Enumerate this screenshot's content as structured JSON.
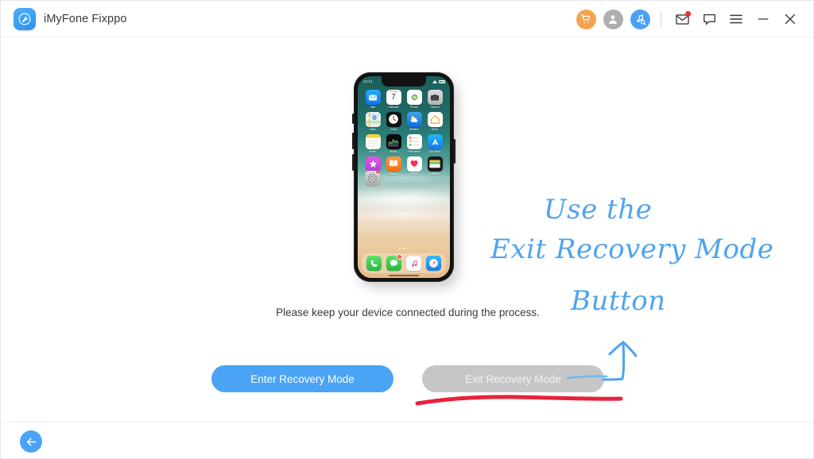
{
  "window": {
    "app_title": "iMyFone Fixppo",
    "logo_icon": "wrench-circle-icon"
  },
  "titlebar": {
    "icons": [
      {
        "name": "cart-icon",
        "glyph": "cart"
      },
      {
        "name": "account-icon",
        "glyph": "person"
      },
      {
        "name": "music-search-icon",
        "glyph": "music-search"
      },
      {
        "name": "mail-icon",
        "glyph": "envelope",
        "badge": true
      },
      {
        "name": "feedback-icon",
        "glyph": "speech-bubble"
      },
      {
        "name": "menu-icon",
        "glyph": "hamburger"
      },
      {
        "name": "minimize-icon",
        "glyph": "minus"
      },
      {
        "name": "close-icon",
        "glyph": "cross"
      }
    ],
    "colors": {
      "cart": "#f4a34e",
      "account": "#aeaeae",
      "music": "#4ba1f2",
      "badge": "#ef2b2b",
      "outline": "#3a3a3a"
    }
  },
  "main": {
    "caption": "Please keep your device connected during the process.",
    "enter_button": "Enter Recovery Mode",
    "exit_button": "Exit Recovery Mode",
    "enter_button_color": "#4ba3f5",
    "exit_button_color": "#c6c6c6"
  },
  "annotation": {
    "line1": "Use the",
    "line2": "Exit Recovery Mode",
    "line3": "Button",
    "ink_color": "#4fa3f0",
    "underline_color": "#e8223c",
    "arrow_icon": "up-arrow-annotation",
    "underline_icon": "red-underline-annotation"
  },
  "phone": {
    "status": {
      "time": "12:14",
      "wifi": "wifi-icon",
      "battery": "battery-icon"
    },
    "apps": [
      {
        "label": "Mail",
        "icon": "mail-app-icon"
      },
      {
        "label": "Calendar",
        "icon": "calendar-app-icon",
        "day": "7",
        "month": "Thursday"
      },
      {
        "label": "Photos",
        "icon": "photos-app-icon"
      },
      {
        "label": "Camera",
        "icon": "camera-app-icon"
      },
      {
        "label": "Maps",
        "icon": "maps-app-icon"
      },
      {
        "label": "Clock",
        "icon": "clock-app-icon"
      },
      {
        "label": "Weather",
        "icon": "weather-app-icon"
      },
      {
        "label": "Home",
        "icon": "home-app-icon"
      },
      {
        "label": "Notes",
        "icon": "notes-app-icon"
      },
      {
        "label": "Stocks",
        "icon": "stocks-app-icon"
      },
      {
        "label": "Reminders",
        "icon": "reminders-app-icon"
      },
      {
        "label": "App Store",
        "icon": "appstore-app-icon"
      },
      {
        "label": "iTunes Store",
        "icon": "itunes-app-icon"
      },
      {
        "label": "iBooks",
        "icon": "books-app-icon"
      },
      {
        "label": "Health",
        "icon": "health-app-icon"
      },
      {
        "label": "Wallet",
        "icon": "wallet-app-icon"
      }
    ],
    "settings": {
      "label": "Settings",
      "icon": "settings-app-icon",
      "badge": "1"
    },
    "dock": [
      {
        "label": "Phone",
        "icon": "phone-app-icon"
      },
      {
        "label": "Messages",
        "icon": "messages-app-icon",
        "badge": "2"
      },
      {
        "label": "Music",
        "icon": "music-app-icon"
      },
      {
        "label": "Safari",
        "icon": "safari-app-icon"
      }
    ]
  },
  "footer": {
    "back_icon": "back-arrow-icon"
  }
}
